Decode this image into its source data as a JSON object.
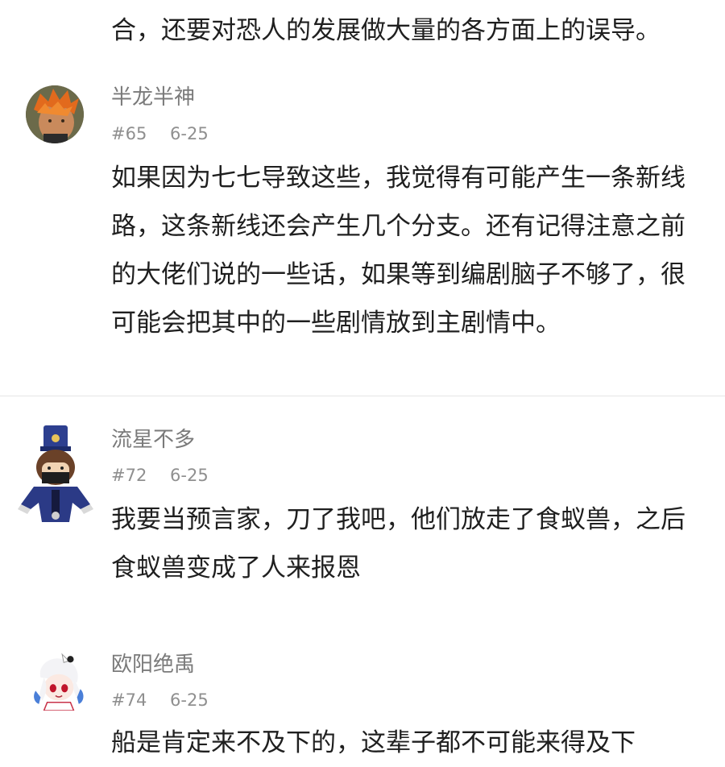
{
  "previous_comment": {
    "text_tail": "合，还要对恐人的发展做大量的各方面上的误导。"
  },
  "comments": [
    {
      "username": "半龙半神",
      "floor": "#65",
      "date": "6-25",
      "content": "如果因为七七导致这些，我觉得有可能产生一条新线路，这条新线还会产生几个分支。还有记得注意之前的大佬们说的一些话，如果等到编剧脑子不够了，很可能会把其中的一些剧情放到主剧情中。"
    },
    {
      "username": "流星不多",
      "floor": "#72",
      "date": "6-25",
      "content": "我要当预言家，刀了我吧，他们放走了食蚁兽，之后食蚁兽变成了人来报恩"
    },
    {
      "username": "欧阳绝禹",
      "floor": "#74",
      "date": "6-25",
      "content": "船是肯定来不及下的，这辈子都不可能来得及下"
    }
  ]
}
